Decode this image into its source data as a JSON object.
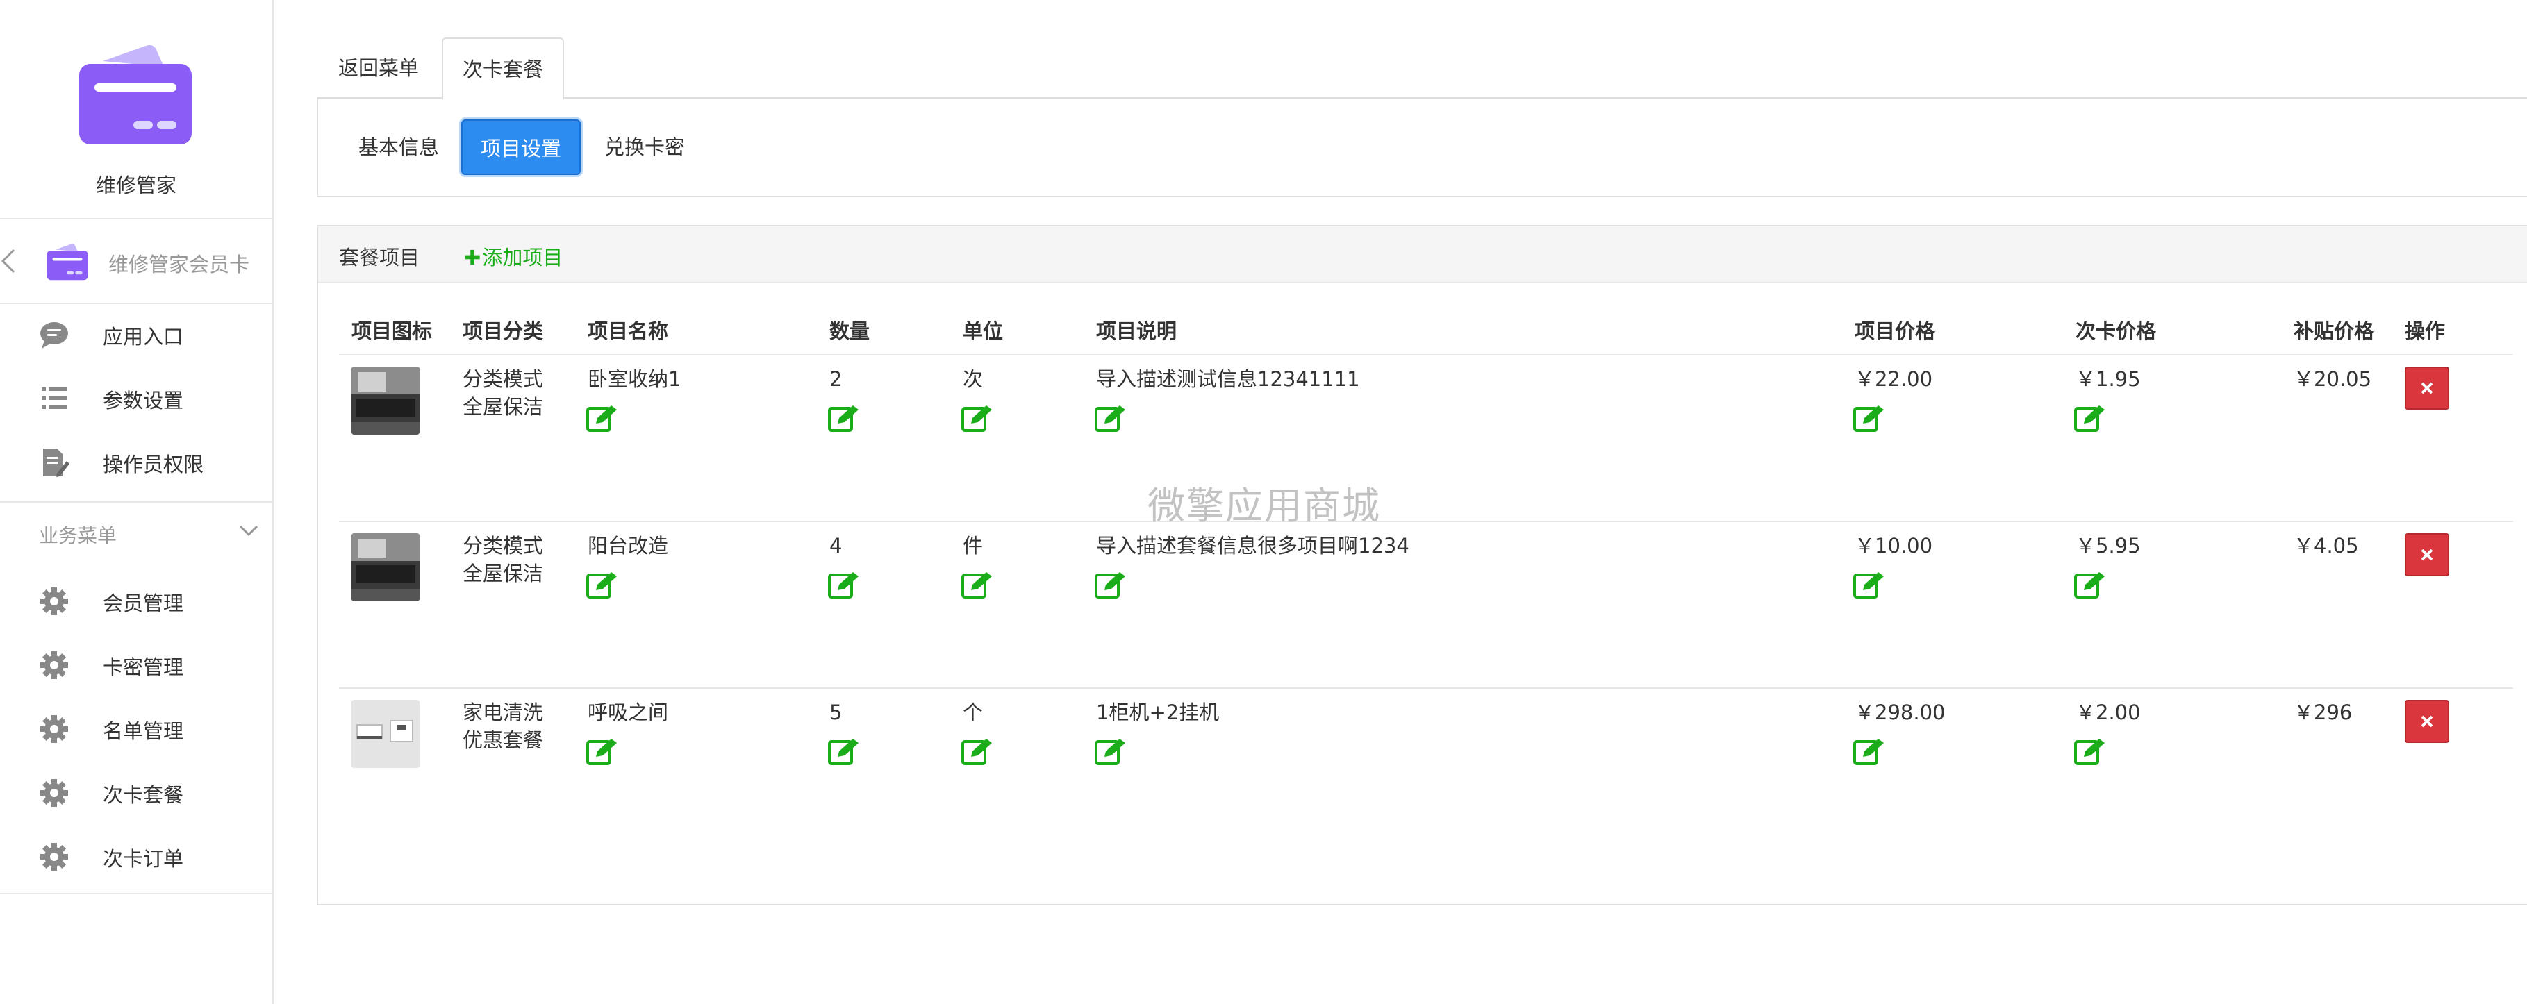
{
  "sidebar": {
    "app_name": "维修管家",
    "back_label": "维修管家会员卡",
    "menu_top": [
      {
        "label": "应用入口",
        "icon": "chat-bubble-icon"
      },
      {
        "label": "参数设置",
        "icon": "list-icon"
      },
      {
        "label": "操作员权限",
        "icon": "document-edit-icon"
      }
    ],
    "section_label": "业务菜单",
    "menu_business": [
      {
        "label": "会员管理",
        "icon": "gear-icon"
      },
      {
        "label": "卡密管理",
        "icon": "gear-icon"
      },
      {
        "label": "名单管理",
        "icon": "gear-icon"
      },
      {
        "label": "次卡套餐",
        "icon": "gear-icon"
      },
      {
        "label": "次卡订单",
        "icon": "gear-icon"
      }
    ]
  },
  "tabs": {
    "back": "返回菜单",
    "active": "次卡套餐"
  },
  "sub_tabs": {
    "basic": "基本信息",
    "items": "项目设置",
    "redeem": "兑换卡密"
  },
  "panel": {
    "title": "套餐项目",
    "add_label": "添加项目"
  },
  "table": {
    "headers": [
      "项目图标",
      "项目分类",
      "项目名称",
      "数量",
      "单位",
      "项目说明",
      "项目价格",
      "次卡价格",
      "补贴价格",
      "操作"
    ],
    "rows": [
      {
        "category_1": "分类模式",
        "category_2": "全屋保洁",
        "name": "卧室收纳1",
        "qty": "2",
        "unit": "次",
        "desc": "导入描述测试信息12341111",
        "price": "￥22.00",
        "card_price": "￥1.95",
        "subsidy": "￥20.05"
      },
      {
        "category_1": "分类模式",
        "category_2": "全屋保洁",
        "name": "阳台改造",
        "qty": "4",
        "unit": "件",
        "desc": "导入描述套餐信息很多项目啊1234",
        "price": "￥10.00",
        "card_price": "￥5.95",
        "subsidy": "￥4.05"
      },
      {
        "category_1": "家电清洗",
        "category_2": "优惠套餐",
        "name": "呼吸之间",
        "qty": "5",
        "unit": "个",
        "desc": "1柜机+2挂机",
        "price": "￥298.00",
        "card_price": "￥2.00",
        "subsidy": "￥296"
      }
    ]
  },
  "watermark": "微擎应用商城",
  "colors": {
    "primary": "#2d8cf0",
    "edit_green": "#1aad19",
    "delete_red": "#d9363e",
    "logo_purple": "#8b5cf6"
  }
}
